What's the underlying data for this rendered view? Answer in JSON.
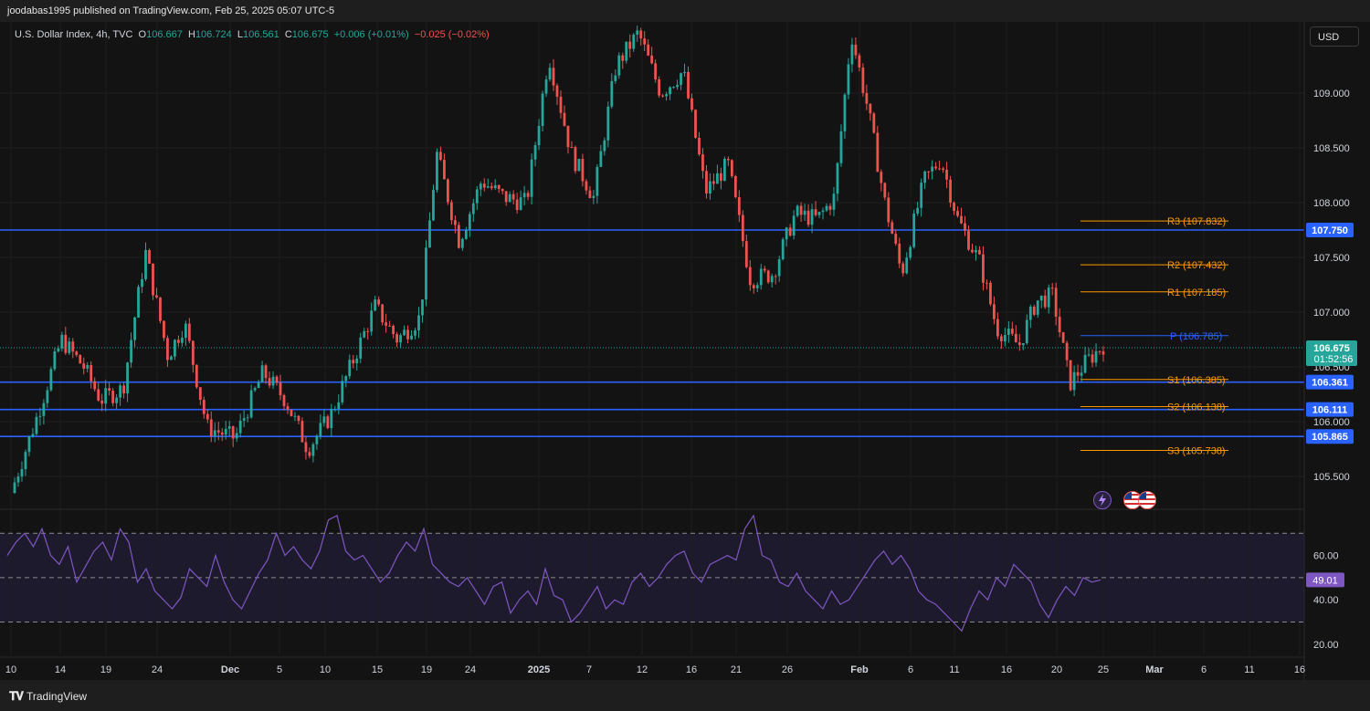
{
  "header": {
    "publisher": "joodabas1995 published on TradingView.com, Feb 25, 2025 05:07 UTC-5"
  },
  "symbol": {
    "name": "U.S. Dollar Index, 4h, TVC",
    "o_label": "O",
    "open": "106.667",
    "h_label": "H",
    "high": "106.724",
    "l_label": "L",
    "low": "106.561",
    "c_label": "C",
    "close": "106.675",
    "change": "+0.006 (+0.01%)",
    "change2": "−0.025 (−0.02%)"
  },
  "currency_button": "USD",
  "footer": {
    "brand": "TradingView"
  },
  "colors": {
    "up": "#26a69a",
    "down": "#ef5350",
    "level": "#2962ff",
    "pivot": "#ff9800",
    "rsi": "#7e57c2"
  },
  "icons": [
    "lightning-icon",
    "us-flag-icon",
    "us-flag-icon"
  ],
  "chart_data": [
    {
      "type": "candlestick",
      "title": "",
      "ylim": [
        105.2,
        109.65
      ],
      "y_ticks": [
        "105.500",
        "106.000",
        "106.500",
        "107.000",
        "107.500",
        "108.000",
        "108.500",
        "109.000"
      ],
      "x_ticks": [
        "10",
        "14",
        "19",
        "24",
        "Dec",
        "5",
        "10",
        "15",
        "19",
        "24",
        "2025",
        "7",
        "12",
        "16",
        "21",
        "26",
        "Feb",
        "6",
        "11",
        "16",
        "20",
        "25",
        "Mar",
        "6",
        "11",
        "16"
      ],
      "price_path": [
        {
          "t": 0,
          "p": 105.35
        },
        {
          "t": 5,
          "p": 106.1
        },
        {
          "t": 9,
          "p": 106.75
        },
        {
          "t": 13,
          "p": 106.5
        },
        {
          "t": 16,
          "p": 106.2
        },
        {
          "t": 20,
          "p": 106.3
        },
        {
          "t": 24,
          "p": 107.55
        },
        {
          "t": 28,
          "p": 106.6
        },
        {
          "t": 31,
          "p": 106.9
        },
        {
          "t": 35,
          "p": 105.95
        },
        {
          "t": 40,
          "p": 105.85
        },
        {
          "t": 45,
          "p": 106.45
        },
        {
          "t": 49,
          "p": 106.2
        },
        {
          "t": 53,
          "p": 105.75
        },
        {
          "t": 57,
          "p": 106.05
        },
        {
          "t": 61,
          "p": 106.55
        },
        {
          "t": 65,
          "p": 107.05
        },
        {
          "t": 69,
          "p": 106.75
        },
        {
          "t": 73,
          "p": 106.95
        },
        {
          "t": 76,
          "p": 108.45
        },
        {
          "t": 80,
          "p": 107.65
        },
        {
          "t": 84,
          "p": 108.2
        },
        {
          "t": 88,
          "p": 108.05
        },
        {
          "t": 92,
          "p": 108.0
        },
        {
          "t": 96,
          "p": 109.35
        },
        {
          "t": 100,
          "p": 108.45
        },
        {
          "t": 104,
          "p": 108.05
        },
        {
          "t": 108,
          "p": 109.25
        },
        {
          "t": 112,
          "p": 109.55
        },
        {
          "t": 116,
          "p": 109.0
        },
        {
          "t": 120,
          "p": 109.2
        },
        {
          "t": 124,
          "p": 108.1
        },
        {
          "t": 128,
          "p": 108.35
        },
        {
          "t": 132,
          "p": 107.3
        },
        {
          "t": 136,
          "p": 107.35
        },
        {
          "t": 140,
          "p": 107.9
        },
        {
          "t": 144,
          "p": 107.85
        },
        {
          "t": 147,
          "p": 108.05
        },
        {
          "t": 150,
          "p": 109.55
        },
        {
          "t": 153,
          "p": 108.85
        },
        {
          "t": 156,
          "p": 108.0
        },
        {
          "t": 159,
          "p": 107.35
        },
        {
          "t": 163,
          "p": 108.2
        },
        {
          "t": 166,
          "p": 108.4
        },
        {
          "t": 169,
          "p": 107.85
        },
        {
          "t": 173,
          "p": 107.45
        },
        {
          "t": 176,
          "p": 106.85
        },
        {
          "t": 180,
          "p": 106.7
        },
        {
          "t": 183,
          "p": 107.1
        },
        {
          "t": 186,
          "p": 107.15
        },
        {
          "t": 189,
          "p": 106.35
        },
        {
          "t": 192,
          "p": 106.55
        },
        {
          "t": 195,
          "p": 106.7
        }
      ],
      "horizontal_levels": [
        {
          "value": 107.75,
          "label": "107.750"
        },
        {
          "value": 106.361,
          "label": "106.361"
        },
        {
          "value": 106.111,
          "label": "106.111"
        },
        {
          "value": 105.865,
          "label": "105.865"
        }
      ],
      "pivots": [
        {
          "name": "R3",
          "value": 107.832,
          "label": "R3 (107.832)"
        },
        {
          "name": "R2",
          "value": 107.432,
          "label": "R2 (107.432)"
        },
        {
          "name": "R1",
          "value": 107.185,
          "label": "R1 (107.185)"
        },
        {
          "name": "P",
          "value": 106.785,
          "label": "P (106.785)"
        },
        {
          "name": "S1",
          "value": 106.385,
          "label": "S1 (106.385)"
        },
        {
          "name": "S2",
          "value": 106.138,
          "label": "S2 (106.138)"
        },
        {
          "name": "S3",
          "value": 105.738,
          "label": "S3 (105.738)"
        }
      ],
      "last_price": {
        "value": 106.675,
        "label": "106.675",
        "countdown": "01:52:56"
      }
    },
    {
      "type": "line",
      "title": "",
      "ylim": [
        15,
        80
      ],
      "y_ticks": [
        "20.00",
        "40.00",
        "60.00"
      ],
      "band": [
        30,
        70
      ],
      "midline": 50,
      "last_value": {
        "value": 49.01,
        "label": "49.01"
      },
      "series": [
        {
          "values": [
            60,
            66,
            70,
            64,
            72,
            60,
            56,
            64,
            48,
            55,
            62,
            66,
            58,
            72,
            66,
            48,
            54,
            44,
            40,
            36,
            41,
            54,
            50,
            46,
            60,
            48,
            40,
            36,
            44,
            52,
            58,
            70,
            60,
            64,
            58,
            54,
            62,
            76,
            78,
            62,
            58,
            60,
            54,
            48,
            52,
            60,
            66,
            62,
            72,
            56,
            52,
            48,
            46,
            50,
            44,
            38,
            46,
            48,
            34,
            40,
            44,
            38,
            54,
            42,
            40,
            30,
            34,
            40,
            46,
            36,
            40,
            38,
            48,
            52,
            46,
            50,
            56,
            60,
            62,
            52,
            48,
            56,
            58,
            60,
            58,
            72,
            78,
            60,
            58,
            48,
            46,
            52,
            44,
            40,
            36,
            44,
            38,
            40,
            46,
            52,
            58,
            62,
            56,
            60,
            54,
            44,
            40,
            38,
            34,
            30,
            26,
            36,
            44,
            40,
            50,
            46,
            56,
            52,
            48,
            38,
            32,
            40,
            46,
            42,
            50,
            48,
            49
          ]
        }
      ]
    }
  ]
}
